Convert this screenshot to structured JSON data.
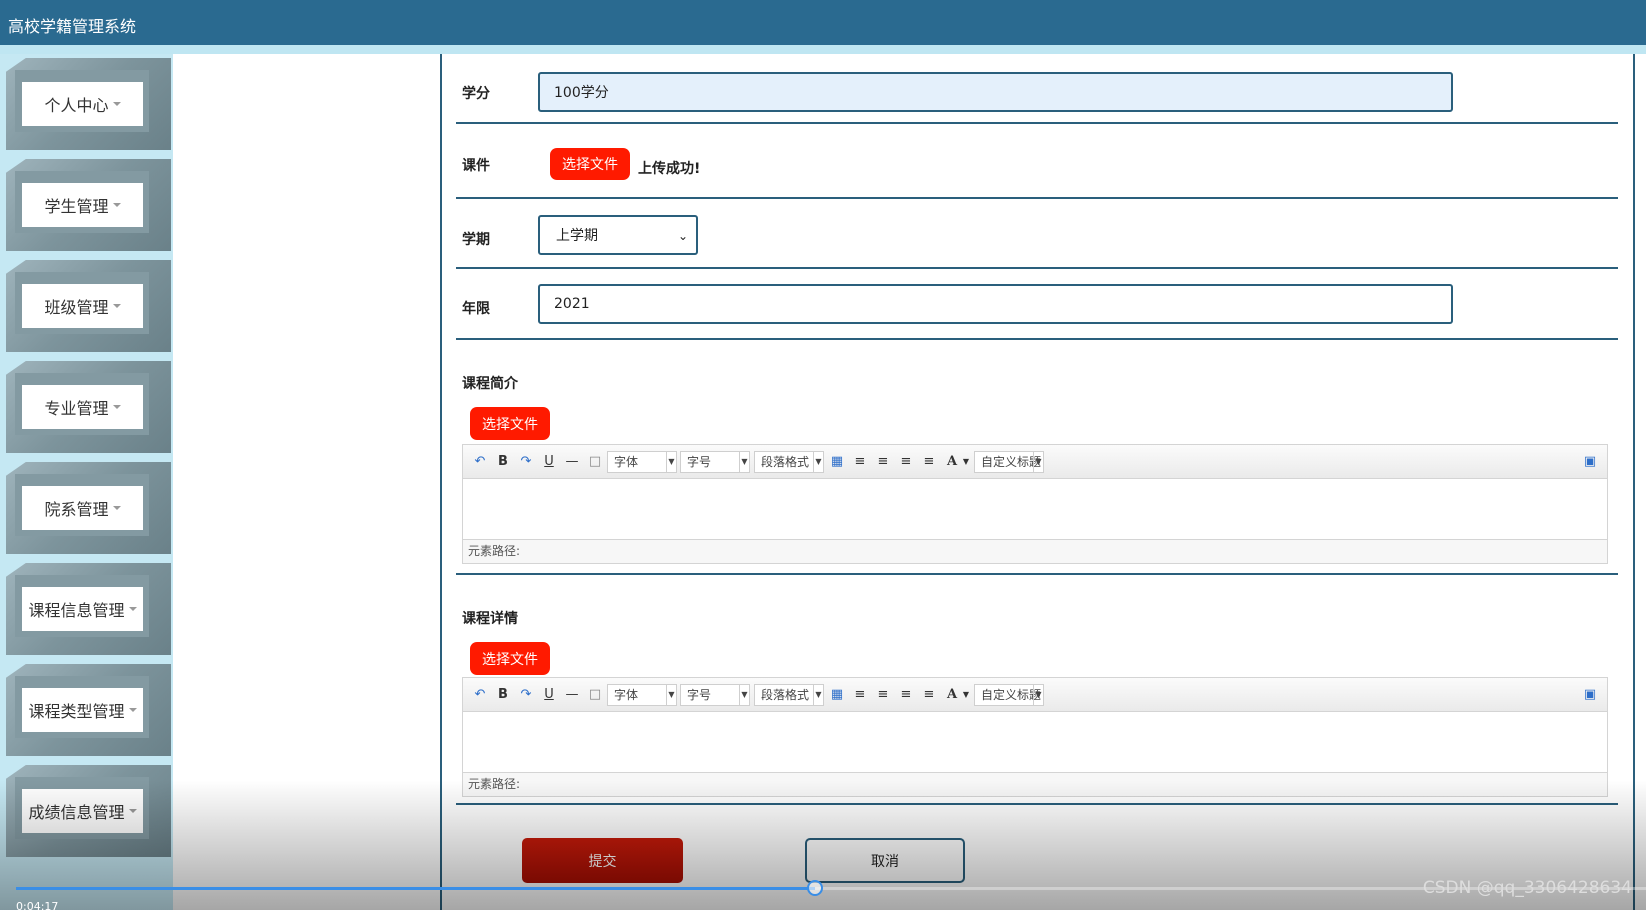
{
  "app": {
    "title": "高校学籍管理系统"
  },
  "sidebar": {
    "items": [
      {
        "label": "个人中心"
      },
      {
        "label": "学生管理"
      },
      {
        "label": "班级管理"
      },
      {
        "label": "专业管理"
      },
      {
        "label": "院系管理"
      },
      {
        "label": "课程信息管理"
      },
      {
        "label": "课程类型管理"
      },
      {
        "label": "成绩信息管理"
      }
    ]
  },
  "form": {
    "credit": {
      "label": "学分",
      "value": "100学分"
    },
    "courseware": {
      "label": "课件",
      "button": "选择文件",
      "status": "上传成功!"
    },
    "semester": {
      "label": "学期",
      "value": "上学期"
    },
    "years": {
      "label": "年限",
      "value": "2021"
    },
    "intro": {
      "label": "课程简介",
      "button": "选择文件"
    },
    "details": {
      "label": "课程详情",
      "button": "选择文件"
    }
  },
  "editor": {
    "font_family": "字体",
    "font_size": "字号",
    "paragraph": "段落格式",
    "custom_title": "自定义标题",
    "element_path": "元素路径:"
  },
  "actions": {
    "submit": "提交",
    "cancel": "取消"
  },
  "player": {
    "time": "0:04:17",
    "progress": 0.49
  },
  "watermark": "CSDN @qq_3306428634"
}
